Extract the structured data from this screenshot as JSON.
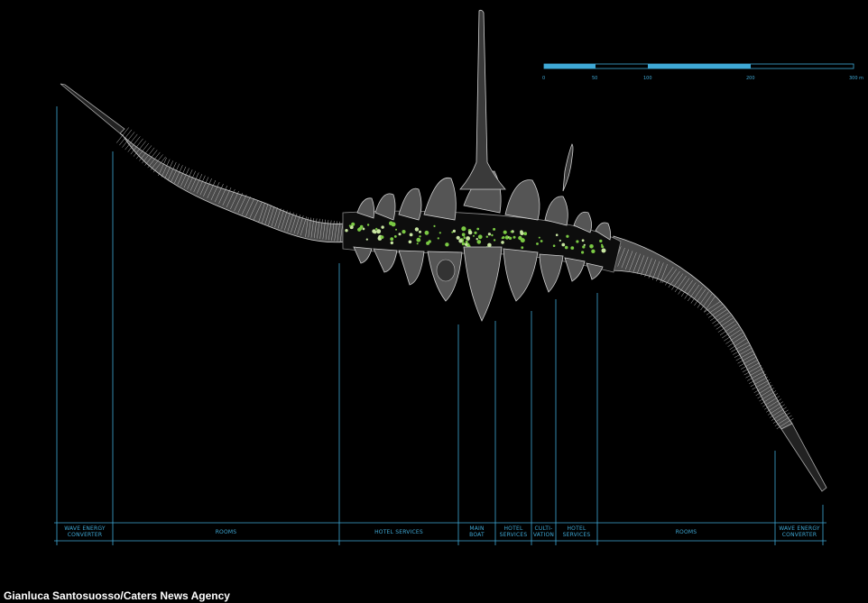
{
  "scale_bar": {
    "ticks": [
      "0",
      "50",
      "100",
      "200",
      "300 m"
    ],
    "colors": {
      "filled": "#3fa9d6",
      "empty": "#000000",
      "outline": "#3fa9d6"
    }
  },
  "segments": [
    {
      "label": "WAVE ENERGY CONVERTER",
      "lines": [
        "WAVE ENERGY",
        "CONVERTER"
      ]
    },
    {
      "label": "ROOMS",
      "lines": [
        "ROOMS"
      ]
    },
    {
      "label": "HOTEL SERVICES",
      "lines": [
        "HOTEL SERVICES"
      ]
    },
    {
      "label": "MAIN BOAT",
      "lines": [
        "MAIN",
        "BOAT"
      ]
    },
    {
      "label": "HOTEL SERVICES",
      "lines": [
        "HOTEL",
        "SERVICES"
      ]
    },
    {
      "label": "CULTIVATION",
      "lines": [
        "CULTI-",
        "VATION"
      ]
    },
    {
      "label": "HOTEL SERVICES",
      "lines": [
        "HOTEL",
        "SERVICES"
      ]
    },
    {
      "label": "ROOMS",
      "lines": [
        "ROOMS"
      ]
    },
    {
      "label": "WAVE ENERGY CONVERTER",
      "lines": [
        "WAVE ENERGY",
        "CONVERTER"
      ]
    }
  ],
  "credit": "Gianluca Santosuosso/Caters News Agency",
  "colors": {
    "background": "#000000",
    "lines": "#3fa9d6",
    "hull": "#4a4a4a",
    "hull_stroke": "#bdbdbd",
    "garden": "#7ac943"
  }
}
